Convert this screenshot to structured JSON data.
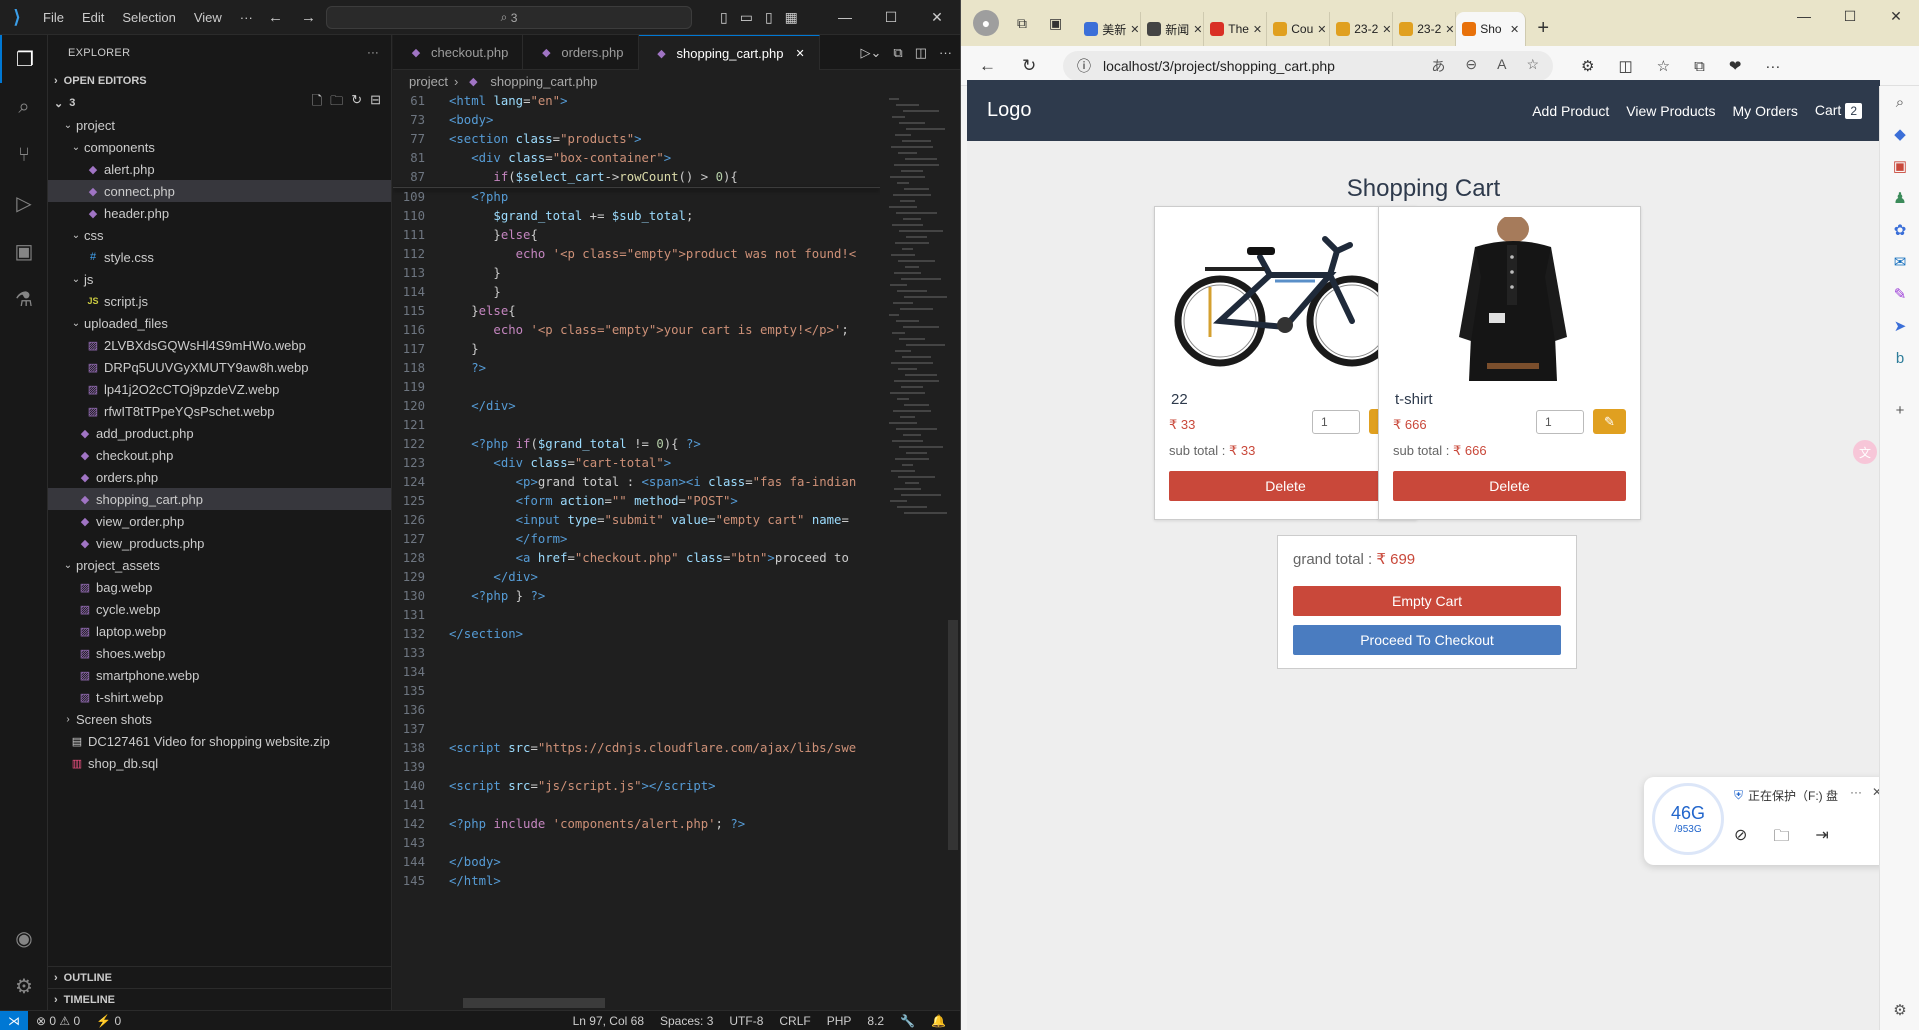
{
  "vscode": {
    "menu": [
      "File",
      "Edit",
      "Selection",
      "View",
      "···"
    ],
    "search": "3",
    "explorer_title": "EXPLORER",
    "open_editors": "OPEN EDITORS",
    "root": "3",
    "tree": [
      {
        "label": "project",
        "depth": 1,
        "type": "folder"
      },
      {
        "label": "components",
        "depth": 2,
        "type": "folder"
      },
      {
        "label": "alert.php",
        "depth": 3,
        "type": "php"
      },
      {
        "label": "connect.php",
        "depth": 3,
        "type": "php",
        "selected": true
      },
      {
        "label": "header.php",
        "depth": 3,
        "type": "php"
      },
      {
        "label": "css",
        "depth": 2,
        "type": "folder"
      },
      {
        "label": "style.css",
        "depth": 3,
        "type": "css"
      },
      {
        "label": "js",
        "depth": 2,
        "type": "folder"
      },
      {
        "label": "script.js",
        "depth": 3,
        "type": "js"
      },
      {
        "label": "uploaded_files",
        "depth": 2,
        "type": "folder"
      },
      {
        "label": "2LVBXdsGQWsHl4S9mHWo.webp",
        "depth": 3,
        "type": "webp"
      },
      {
        "label": "DRPq5UUVGyXMUTY9aw8h.webp",
        "depth": 3,
        "type": "webp"
      },
      {
        "label": "lp41j2O2cCTOj9pzdeVZ.webp",
        "depth": 3,
        "type": "webp"
      },
      {
        "label": "rfwIT8tTPpeYQsPschet.webp",
        "depth": 3,
        "type": "webp"
      },
      {
        "label": "add_product.php",
        "depth": 2,
        "type": "php"
      },
      {
        "label": "checkout.php",
        "depth": 2,
        "type": "php"
      },
      {
        "label": "orders.php",
        "depth": 2,
        "type": "php"
      },
      {
        "label": "shopping_cart.php",
        "depth": 2,
        "type": "php",
        "selected": true
      },
      {
        "label": "view_order.php",
        "depth": 2,
        "type": "php"
      },
      {
        "label": "view_products.php",
        "depth": 2,
        "type": "php"
      },
      {
        "label": "project_assets",
        "depth": 1,
        "type": "folder"
      },
      {
        "label": "bag.webp",
        "depth": 2,
        "type": "webp"
      },
      {
        "label": "cycle.webp",
        "depth": 2,
        "type": "webp"
      },
      {
        "label": "laptop.webp",
        "depth": 2,
        "type": "webp"
      },
      {
        "label": "shoes.webp",
        "depth": 2,
        "type": "webp"
      },
      {
        "label": "smartphone.webp",
        "depth": 2,
        "type": "webp"
      },
      {
        "label": "t-shirt.webp",
        "depth": 2,
        "type": "webp"
      },
      {
        "label": "Screen shots",
        "depth": 1,
        "type": "folder-closed"
      },
      {
        "label": "DC127461 Video for shopping website.zip",
        "depth": 1,
        "type": "zip"
      },
      {
        "label": "shop_db.sql",
        "depth": 1,
        "type": "sql"
      }
    ],
    "outline": "OUTLINE",
    "timeline": "TIMELINE",
    "tabs": [
      {
        "label": "checkout.php"
      },
      {
        "label": "orders.php"
      },
      {
        "label": "shopping_cart.php",
        "active": true
      }
    ],
    "breadcrumb": [
      "project",
      "shopping_cart.php"
    ],
    "sticky_lines": [
      {
        "n": "61",
        "html": "<span class='tk-tag'>&lt;html</span> <span class='tk-attr'>lang</span>=<span class='tk-str'>\"en\"</span><span class='tk-tag'>&gt;</span>"
      },
      {
        "n": "73",
        "html": "<span class='tk-tag'>&lt;body&gt;</span>"
      },
      {
        "n": "77",
        "html": "<span class='tk-tag'>&lt;section</span> <span class='tk-attr'>class</span>=<span class='tk-str'>\"products\"</span><span class='tk-tag'>&gt;</span>"
      },
      {
        "n": "81",
        "html": "   <span class='tk-tag'>&lt;div</span> <span class='tk-attr'>class</span>=<span class='tk-str'>\"box-container\"</span><span class='tk-tag'>&gt;</span>"
      },
      {
        "n": "87",
        "html": "      <span class='tk-kw'>if</span>(<span class='tk-var'>$select_cart</span>-&gt;<span class='tk-fn'>rowCount</span>() &gt; <span class='tk-num'>0</span>){"
      }
    ],
    "code_lines": [
      {
        "n": "109",
        "html": "   <span class='tk-php'>&lt;?php</span>"
      },
      {
        "n": "110",
        "html": "      <span class='tk-var'>$grand_total</span> += <span class='tk-var'>$sub_total</span>;"
      },
      {
        "n": "111",
        "html": "      }<span class='tk-kw'>else</span>{"
      },
      {
        "n": "112",
        "html": "         <span class='tk-kw'>echo</span> <span class='tk-str'>'&lt;p class=\"empty\"&gt;product was not found!&lt;</span>"
      },
      {
        "n": "113",
        "html": "      }"
      },
      {
        "n": "114",
        "html": "      }"
      },
      {
        "n": "115",
        "html": "   }<span class='tk-kw'>else</span>{"
      },
      {
        "n": "116",
        "html": "      <span class='tk-kw'>echo</span> <span class='tk-str'>'&lt;p class=\"empty\"&gt;your cart is empty!&lt;/p&gt;'</span>;"
      },
      {
        "n": "117",
        "html": "   }"
      },
      {
        "n": "118",
        "html": "   <span class='tk-php'>?&gt;</span>"
      },
      {
        "n": "119",
        "html": ""
      },
      {
        "n": "120",
        "html": "   <span class='tk-tag'>&lt;/div&gt;</span>"
      },
      {
        "n": "121",
        "html": ""
      },
      {
        "n": "122",
        "html": "   <span class='tk-php'>&lt;?php</span> <span class='tk-kw'>if</span>(<span class='tk-var'>$grand_total</span> != <span class='tk-num'>0</span>){ <span class='tk-php'>?&gt;</span>"
      },
      {
        "n": "123",
        "html": "      <span class='tk-tag'>&lt;div</span> <span class='tk-attr'>class</span>=<span class='tk-str'>\"cart-total\"</span><span class='tk-tag'>&gt;</span>"
      },
      {
        "n": "124",
        "html": "         <span class='tk-tag'>&lt;p&gt;</span>grand total : <span class='tk-tag'>&lt;span&gt;&lt;i</span> <span class='tk-attr'>class</span>=<span class='tk-str'>\"fas fa-indian</span>"
      },
      {
        "n": "125",
        "html": "         <span class='tk-tag'>&lt;form</span> <span class='tk-attr'>action</span>=<span class='tk-str'>\"\"</span> <span class='tk-attr'>method</span>=<span class='tk-str'>\"POST\"</span><span class='tk-tag'>&gt;</span>"
      },
      {
        "n": "126",
        "html": "         <span class='tk-tag'>&lt;input</span> <span class='tk-attr'>type</span>=<span class='tk-str'>\"submit\"</span> <span class='tk-attr'>value</span>=<span class='tk-str'>\"empty cart\"</span> <span class='tk-attr'>name</span>="
      },
      {
        "n": "127",
        "html": "         <span class='tk-tag'>&lt;/form&gt;</span>"
      },
      {
        "n": "128",
        "html": "         <span class='tk-tag'>&lt;a</span> <span class='tk-attr'>href</span>=<span class='tk-str'>\"checkout.php\"</span> <span class='tk-attr'>class</span>=<span class='tk-str'>\"btn\"</span><span class='tk-tag'>&gt;</span>proceed to"
      },
      {
        "n": "129",
        "html": "      <span class='tk-tag'>&lt;/div&gt;</span>"
      },
      {
        "n": "130",
        "html": "   <span class='tk-php'>&lt;?php</span> } <span class='tk-php'>?&gt;</span>"
      },
      {
        "n": "131",
        "html": ""
      },
      {
        "n": "132",
        "html": "<span class='tk-tag'>&lt;/section&gt;</span>"
      },
      {
        "n": "133",
        "html": ""
      },
      {
        "n": "134",
        "html": ""
      },
      {
        "n": "135",
        "html": ""
      },
      {
        "n": "136",
        "html": ""
      },
      {
        "n": "137",
        "html": ""
      },
      {
        "n": "138",
        "html": "<span class='tk-tag'>&lt;script</span> <span class='tk-attr'>src</span>=<span class='tk-str'>\"https://cdnjs.cloudflare.com/ajax/libs/swe</span>"
      },
      {
        "n": "139",
        "html": ""
      },
      {
        "n": "140",
        "html": "<span class='tk-tag'>&lt;script</span> <span class='tk-attr'>src</span>=<span class='tk-str'>\"js/script.js\"</span><span class='tk-tag'>&gt;&lt;/script&gt;</span>"
      },
      {
        "n": "141",
        "html": ""
      },
      {
        "n": "142",
        "html": "<span class='tk-php'>&lt;?php</span> <span class='tk-kw'>include</span> <span class='tk-str'>'components/alert.php'</span>; <span class='tk-php'>?&gt;</span>"
      },
      {
        "n": "143",
        "html": ""
      },
      {
        "n": "144",
        "html": "<span class='tk-tag'>&lt;/body&gt;</span>"
      },
      {
        "n": "145",
        "html": "<span class='tk-tag'>&lt;/html&gt;</span>"
      }
    ],
    "status": {
      "errors": "⊗ 0 ⚠ 0",
      "ports": "⚡ 0",
      "position": "Ln 97, Col 68",
      "spaces": "Spaces: 3",
      "encoding": "UTF-8",
      "eol": "CRLF",
      "language": "PHP",
      "version": "8.2"
    }
  },
  "browser": {
    "tabs": [
      {
        "label": "美新",
        "color": "#3b6fd8"
      },
      {
        "label": "新闻",
        "color": "#444444"
      },
      {
        "label": "The",
        "color": "#d93025"
      },
      {
        "label": "Cou",
        "color": "#e0a020"
      },
      {
        "label": "23-2",
        "color": "#e0a020"
      },
      {
        "label": "23-2",
        "color": "#e0a020"
      },
      {
        "label": "Sho",
        "color": "#e8710a",
        "active": true
      }
    ],
    "url": "localhost/3/project/shopping_cart.php",
    "site": {
      "logo": "Logo",
      "nav": [
        "Add Product",
        "View Products",
        "My Orders",
        "Cart"
      ],
      "cart_count": "2",
      "title": "Shopping Cart",
      "products": [
        {
          "name": "22",
          "price": "₹ 33",
          "qty": "1",
          "subtotal_label": "sub total :",
          "subtotal": "₹ 33",
          "delete": "Delete",
          "image": "bicycle"
        },
        {
          "name": "t-shirt",
          "price": "₹ 666",
          "qty": "1",
          "subtotal_label": "sub total :",
          "subtotal": "₹ 666",
          "delete": "Delete",
          "image": "tshirt"
        }
      ],
      "grand_total_label": "grand total :",
      "grand_total": "₹ 699",
      "empty_cart": "Empty Cart",
      "checkout": "Proceed To Checkout"
    },
    "widget": {
      "size_big": "46G",
      "size_small": "/953G",
      "status": "正在保护（F:) 盘"
    }
  }
}
